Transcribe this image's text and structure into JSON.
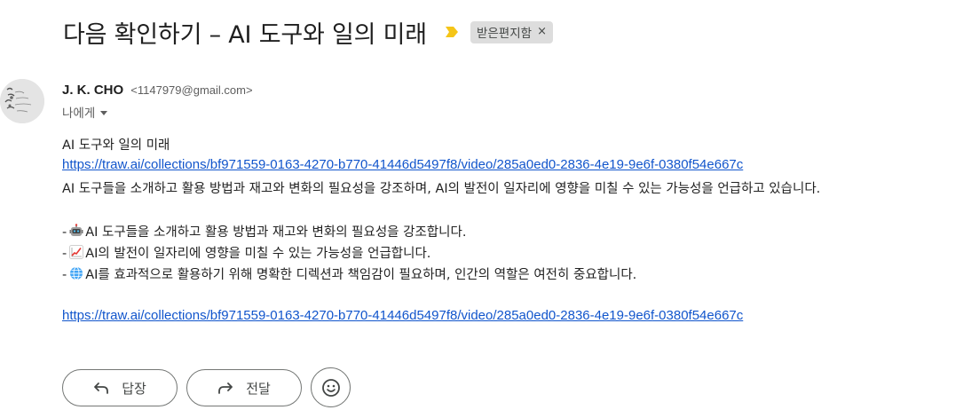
{
  "header": {
    "subject": "다음 확인하기 – AI 도구와 일의 미래",
    "label": "받은편지함",
    "label_remove": "×"
  },
  "sender": {
    "name": "J. K. CHO",
    "email": "<1147979@gmail.com>",
    "recipient": "나에게"
  },
  "message": {
    "title": "AI 도구와 일의 미래",
    "link1": "https://traw.ai/collections/bf971559-0163-4270-b770-41446d5497f8/video/285a0ed0-2836-4e19-9e6f-0380f54e667c",
    "summary": "AI 도구들을 소개하고 활용 방법과 재고와 변화의 필요성을 강조하며, AI의 발전이 일자리에 영향을 미칠 수 있는 가능성을 언급하고 있습니다.",
    "bullets": [
      {
        "prefix": "-",
        "icon": "robot-icon",
        "text": "AI 도구들을 소개하고 활용 방법과 재고와 변화의 필요성을 강조합니다."
      },
      {
        "prefix": "-",
        "icon": "chart-increasing-icon",
        "text": "AI의 발전이 일자리에 영향을 미칠 수 있는 가능성을 언급합니다."
      },
      {
        "prefix": "-",
        "icon": "globe-icon",
        "text": "AI를 효과적으로 활용하기 위해 명확한 디렉션과 책임감이 필요하며, 인간의 역할은 여전히 중요합니다."
      }
    ],
    "link2": "https://traw.ai/collections/bf971559-0163-4270-b770-41446d5497f8/video/285a0ed0-2836-4e19-9e6f-0380f54e667c"
  },
  "actions": {
    "reply": "답장",
    "forward": "전달"
  },
  "colors": {
    "link": "#1155cc",
    "importance": "#f5c518",
    "chip_bg": "#dddddd"
  }
}
